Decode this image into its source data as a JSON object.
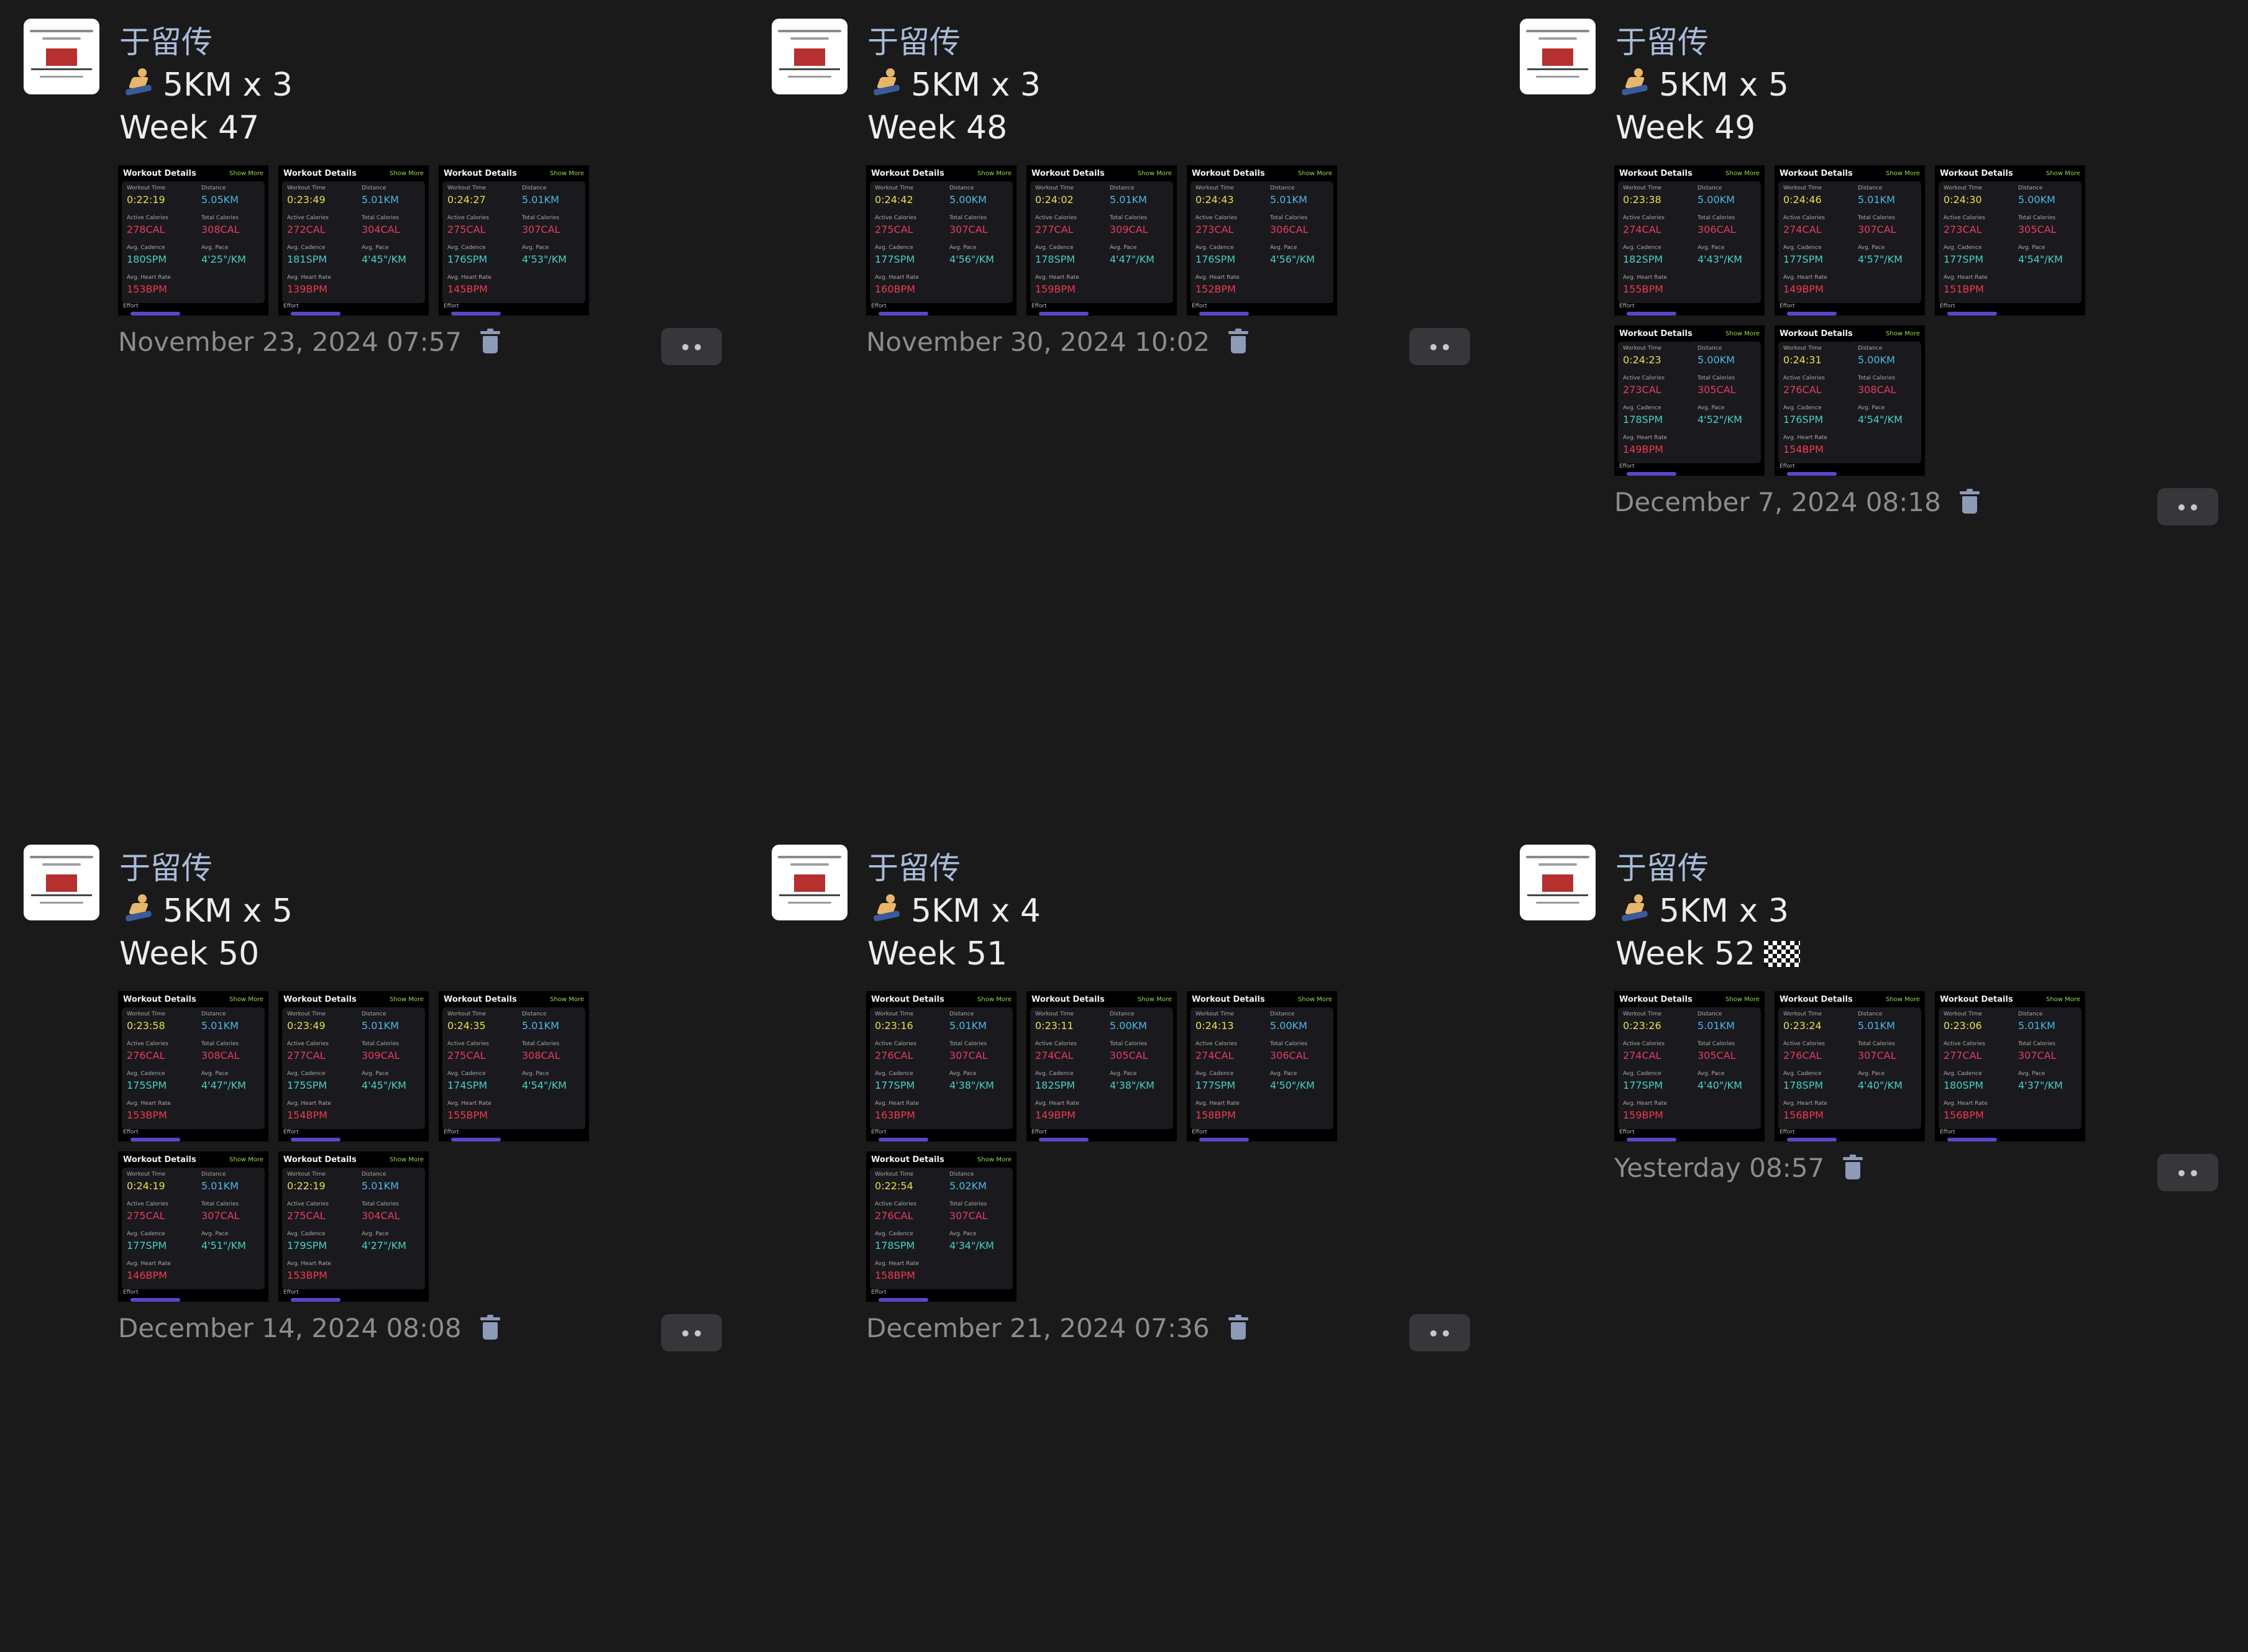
{
  "posts": [
    {
      "author": "于留传",
      "distance_label": "5KM x 3",
      "week": "Week 47",
      "flag": false,
      "timestamp": "November 23, 2024 07:57",
      "workouts": [
        {
          "time": "0:22:19",
          "distance": "5.05KM",
          "active_cal": "278CAL",
          "total_cal": "308CAL",
          "cadence": "180SPM",
          "pace": "4'25\"/KM",
          "hr": "153BPM"
        },
        {
          "time": "0:23:49",
          "distance": "5.01KM",
          "active_cal": "272CAL",
          "total_cal": "304CAL",
          "cadence": "181SPM",
          "pace": "4'45\"/KM",
          "hr": "139BPM"
        },
        {
          "time": "0:24:27",
          "distance": "5.01KM",
          "active_cal": "275CAL",
          "total_cal": "307CAL",
          "cadence": "176SPM",
          "pace": "4'53\"/KM",
          "hr": "145BPM"
        }
      ]
    },
    {
      "author": "于留传",
      "distance_label": "5KM x 3",
      "week": "Week 48",
      "flag": false,
      "timestamp": "November 30, 2024 10:02",
      "workouts": [
        {
          "time": "0:24:42",
          "distance": "5.00KM",
          "active_cal": "275CAL",
          "total_cal": "307CAL",
          "cadence": "177SPM",
          "pace": "4'56\"/KM",
          "hr": "160BPM"
        },
        {
          "time": "0:24:02",
          "distance": "5.01KM",
          "active_cal": "277CAL",
          "total_cal": "309CAL",
          "cadence": "178SPM",
          "pace": "4'47\"/KM",
          "hr": "159BPM"
        },
        {
          "time": "0:24:43",
          "distance": "5.01KM",
          "active_cal": "273CAL",
          "total_cal": "306CAL",
          "cadence": "176SPM",
          "pace": "4'56\"/KM",
          "hr": "152BPM"
        }
      ]
    },
    {
      "author": "于留传",
      "distance_label": "5KM x 5",
      "week": "Week 49",
      "flag": false,
      "timestamp": "December 7, 2024 08:18",
      "workouts": [
        {
          "time": "0:23:38",
          "distance": "5.00KM",
          "active_cal": "274CAL",
          "total_cal": "306CAL",
          "cadence": "182SPM",
          "pace": "4'43\"/KM",
          "hr": "155BPM"
        },
        {
          "time": "0:24:46",
          "distance": "5.01KM",
          "active_cal": "274CAL",
          "total_cal": "307CAL",
          "cadence": "177SPM",
          "pace": "4'57\"/KM",
          "hr": "149BPM"
        },
        {
          "time": "0:24:30",
          "distance": "5.00KM",
          "active_cal": "273CAL",
          "total_cal": "305CAL",
          "cadence": "177SPM",
          "pace": "4'54\"/KM",
          "hr": "151BPM"
        },
        {
          "time": "0:24:23",
          "distance": "5.00KM",
          "active_cal": "273CAL",
          "total_cal": "305CAL",
          "cadence": "178SPM",
          "pace": "4'52\"/KM",
          "hr": "149BPM"
        },
        {
          "time": "0:24:31",
          "distance": "5.00KM",
          "active_cal": "276CAL",
          "total_cal": "308CAL",
          "cadence": "176SPM",
          "pace": "4'54\"/KM",
          "hr": "154BPM"
        }
      ]
    },
    {
      "author": "于留传",
      "distance_label": "5KM x 5",
      "week": "Week 50",
      "flag": false,
      "timestamp": "December 14, 2024 08:08",
      "workouts": [
        {
          "time": "0:23:58",
          "distance": "5.01KM",
          "active_cal": "276CAL",
          "total_cal": "308CAL",
          "cadence": "175SPM",
          "pace": "4'47\"/KM",
          "hr": "153BPM"
        },
        {
          "time": "0:23:49",
          "distance": "5.01KM",
          "active_cal": "277CAL",
          "total_cal": "309CAL",
          "cadence": "175SPM",
          "pace": "4'45\"/KM",
          "hr": "154BPM"
        },
        {
          "time": "0:24:35",
          "distance": "5.01KM",
          "active_cal": "275CAL",
          "total_cal": "308CAL",
          "cadence": "174SPM",
          "pace": "4'54\"/KM",
          "hr": "155BPM"
        },
        {
          "time": "0:24:19",
          "distance": "5.01KM",
          "active_cal": "275CAL",
          "total_cal": "307CAL",
          "cadence": "177SPM",
          "pace": "4'51\"/KM",
          "hr": "146BPM"
        },
        {
          "time": "0:22:19",
          "distance": "5.01KM",
          "active_cal": "275CAL",
          "total_cal": "304CAL",
          "cadence": "179SPM",
          "pace": "4'27\"/KM",
          "hr": "153BPM"
        }
      ]
    },
    {
      "author": "于留传",
      "distance_label": "5KM x 4",
      "week": "Week 51",
      "flag": false,
      "timestamp": "December 21, 2024 07:36",
      "workouts": [
        {
          "time": "0:23:16",
          "distance": "5.01KM",
          "active_cal": "276CAL",
          "total_cal": "307CAL",
          "cadence": "177SPM",
          "pace": "4'38\"/KM",
          "hr": "163BPM"
        },
        {
          "time": "0:23:11",
          "distance": "5.00KM",
          "active_cal": "274CAL",
          "total_cal": "305CAL",
          "cadence": "182SPM",
          "pace": "4'38\"/KM",
          "hr": "149BPM"
        },
        {
          "time": "0:24:13",
          "distance": "5.00KM",
          "active_cal": "274CAL",
          "total_cal": "306CAL",
          "cadence": "177SPM",
          "pace": "4'50\"/KM",
          "hr": "158BPM"
        },
        {
          "time": "0:22:54",
          "distance": "5.02KM",
          "active_cal": "276CAL",
          "total_cal": "307CAL",
          "cadence": "178SPM",
          "pace": "4'34\"/KM",
          "hr": "158BPM"
        }
      ]
    },
    {
      "author": "于留传",
      "distance_label": "5KM x 3",
      "week": "Week 52",
      "flag": true,
      "timestamp": "Yesterday 08:57",
      "workouts": [
        {
          "time": "0:23:26",
          "distance": "5.01KM",
          "active_cal": "274CAL",
          "total_cal": "305CAL",
          "cadence": "177SPM",
          "pace": "4'40\"/KM",
          "hr": "159BPM"
        },
        {
          "time": "0:23:24",
          "distance": "5.01KM",
          "active_cal": "276CAL",
          "total_cal": "307CAL",
          "cadence": "178SPM",
          "pace": "4'40\"/KM",
          "hr": "156BPM"
        },
        {
          "time": "0:23:06",
          "distance": "5.01KM",
          "active_cal": "277CAL",
          "total_cal": "307CAL",
          "cadence": "180SPM",
          "pace": "4'37\"/KM",
          "hr": "156BPM"
        }
      ]
    }
  ],
  "thumb_labels": {
    "header": "Workout Details",
    "show_more": "Show More",
    "time": "Workout Time",
    "distance": "Distance",
    "active_cal": "Active Calories",
    "total_cal": "Total Calories",
    "cadence": "Avg. Cadence",
    "pace": "Avg. Pace",
    "hr": "Avg. Heart Rate",
    "effort": "Effort"
  },
  "icons": {
    "trash": "trash-icon",
    "more": "more-dots-icon",
    "runner": "runner-emoji-icon",
    "flag": "checkered-flag-icon"
  },
  "colors": {
    "background": "#1a1a1b",
    "author": "#a9bbd8",
    "timestamp": "#8c8c8c",
    "time_value": "#e6e04a",
    "distance_value": "#4ab8e8",
    "calorie_value": "#e83a5e",
    "pace_value": "#45d1c4",
    "heart_rate_value": "#f0394d"
  }
}
